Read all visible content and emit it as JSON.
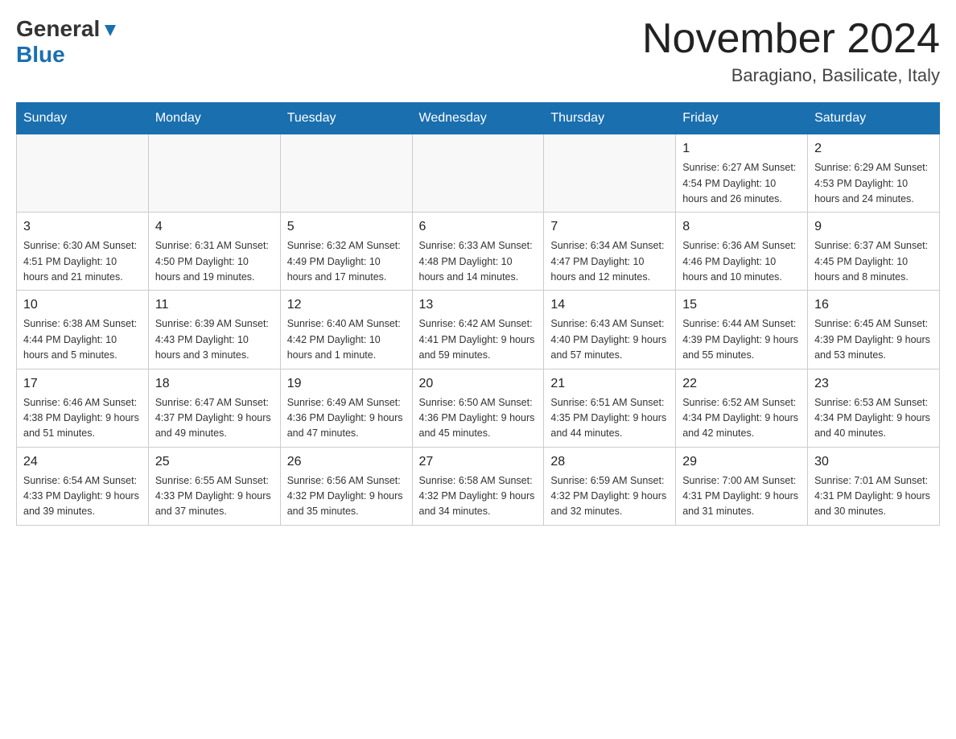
{
  "header": {
    "logo_general": "General",
    "logo_blue": "Blue",
    "month_title": "November 2024",
    "location": "Baragiano, Basilicate, Italy"
  },
  "weekdays": [
    "Sunday",
    "Monday",
    "Tuesday",
    "Wednesday",
    "Thursday",
    "Friday",
    "Saturday"
  ],
  "weeks": [
    [
      {
        "day": "",
        "info": ""
      },
      {
        "day": "",
        "info": ""
      },
      {
        "day": "",
        "info": ""
      },
      {
        "day": "",
        "info": ""
      },
      {
        "day": "",
        "info": ""
      },
      {
        "day": "1",
        "info": "Sunrise: 6:27 AM\nSunset: 4:54 PM\nDaylight: 10 hours and 26 minutes."
      },
      {
        "day": "2",
        "info": "Sunrise: 6:29 AM\nSunset: 4:53 PM\nDaylight: 10 hours and 24 minutes."
      }
    ],
    [
      {
        "day": "3",
        "info": "Sunrise: 6:30 AM\nSunset: 4:51 PM\nDaylight: 10 hours and 21 minutes."
      },
      {
        "day": "4",
        "info": "Sunrise: 6:31 AM\nSunset: 4:50 PM\nDaylight: 10 hours and 19 minutes."
      },
      {
        "day": "5",
        "info": "Sunrise: 6:32 AM\nSunset: 4:49 PM\nDaylight: 10 hours and 17 minutes."
      },
      {
        "day": "6",
        "info": "Sunrise: 6:33 AM\nSunset: 4:48 PM\nDaylight: 10 hours and 14 minutes."
      },
      {
        "day": "7",
        "info": "Sunrise: 6:34 AM\nSunset: 4:47 PM\nDaylight: 10 hours and 12 minutes."
      },
      {
        "day": "8",
        "info": "Sunrise: 6:36 AM\nSunset: 4:46 PM\nDaylight: 10 hours and 10 minutes."
      },
      {
        "day": "9",
        "info": "Sunrise: 6:37 AM\nSunset: 4:45 PM\nDaylight: 10 hours and 8 minutes."
      }
    ],
    [
      {
        "day": "10",
        "info": "Sunrise: 6:38 AM\nSunset: 4:44 PM\nDaylight: 10 hours and 5 minutes."
      },
      {
        "day": "11",
        "info": "Sunrise: 6:39 AM\nSunset: 4:43 PM\nDaylight: 10 hours and 3 minutes."
      },
      {
        "day": "12",
        "info": "Sunrise: 6:40 AM\nSunset: 4:42 PM\nDaylight: 10 hours and 1 minute."
      },
      {
        "day": "13",
        "info": "Sunrise: 6:42 AM\nSunset: 4:41 PM\nDaylight: 9 hours and 59 minutes."
      },
      {
        "day": "14",
        "info": "Sunrise: 6:43 AM\nSunset: 4:40 PM\nDaylight: 9 hours and 57 minutes."
      },
      {
        "day": "15",
        "info": "Sunrise: 6:44 AM\nSunset: 4:39 PM\nDaylight: 9 hours and 55 minutes."
      },
      {
        "day": "16",
        "info": "Sunrise: 6:45 AM\nSunset: 4:39 PM\nDaylight: 9 hours and 53 minutes."
      }
    ],
    [
      {
        "day": "17",
        "info": "Sunrise: 6:46 AM\nSunset: 4:38 PM\nDaylight: 9 hours and 51 minutes."
      },
      {
        "day": "18",
        "info": "Sunrise: 6:47 AM\nSunset: 4:37 PM\nDaylight: 9 hours and 49 minutes."
      },
      {
        "day": "19",
        "info": "Sunrise: 6:49 AM\nSunset: 4:36 PM\nDaylight: 9 hours and 47 minutes."
      },
      {
        "day": "20",
        "info": "Sunrise: 6:50 AM\nSunset: 4:36 PM\nDaylight: 9 hours and 45 minutes."
      },
      {
        "day": "21",
        "info": "Sunrise: 6:51 AM\nSunset: 4:35 PM\nDaylight: 9 hours and 44 minutes."
      },
      {
        "day": "22",
        "info": "Sunrise: 6:52 AM\nSunset: 4:34 PM\nDaylight: 9 hours and 42 minutes."
      },
      {
        "day": "23",
        "info": "Sunrise: 6:53 AM\nSunset: 4:34 PM\nDaylight: 9 hours and 40 minutes."
      }
    ],
    [
      {
        "day": "24",
        "info": "Sunrise: 6:54 AM\nSunset: 4:33 PM\nDaylight: 9 hours and 39 minutes."
      },
      {
        "day": "25",
        "info": "Sunrise: 6:55 AM\nSunset: 4:33 PM\nDaylight: 9 hours and 37 minutes."
      },
      {
        "day": "26",
        "info": "Sunrise: 6:56 AM\nSunset: 4:32 PM\nDaylight: 9 hours and 35 minutes."
      },
      {
        "day": "27",
        "info": "Sunrise: 6:58 AM\nSunset: 4:32 PM\nDaylight: 9 hours and 34 minutes."
      },
      {
        "day": "28",
        "info": "Sunrise: 6:59 AM\nSunset: 4:32 PM\nDaylight: 9 hours and 32 minutes."
      },
      {
        "day": "29",
        "info": "Sunrise: 7:00 AM\nSunset: 4:31 PM\nDaylight: 9 hours and 31 minutes."
      },
      {
        "day": "30",
        "info": "Sunrise: 7:01 AM\nSunset: 4:31 PM\nDaylight: 9 hours and 30 minutes."
      }
    ]
  ]
}
